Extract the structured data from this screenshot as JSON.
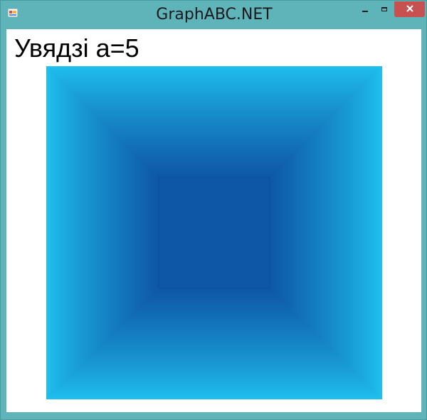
{
  "window": {
    "title": "GraphABC.NET"
  },
  "titlebar_buttons": {
    "minimize": "minimize",
    "maximize": "maximize",
    "close": "close"
  },
  "content": {
    "prompt": "Увядзі a=5"
  },
  "drawing": {
    "shape": "nested-squares-gradient",
    "outer_color": "#1fc0ee",
    "inner_color": "#0e56a6"
  }
}
